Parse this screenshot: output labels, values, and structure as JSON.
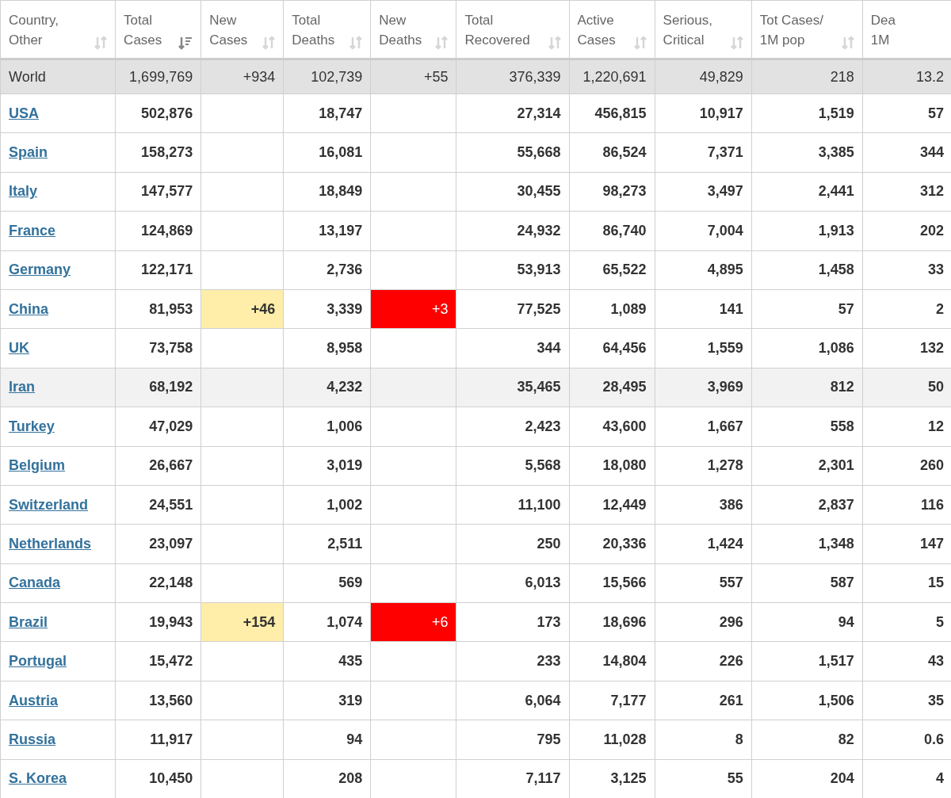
{
  "table": {
    "columns": [
      {
        "kind": "sortable",
        "lines": [
          "Country,",
          "Other"
        ],
        "sorted": false
      },
      {
        "kind": "sortable",
        "lines": [
          "Total",
          "Cases"
        ],
        "sorted": true
      },
      {
        "kind": "sortable",
        "lines": [
          "New",
          "Cases"
        ],
        "sorted": false
      },
      {
        "kind": "sortable",
        "lines": [
          "Total",
          "Deaths"
        ],
        "sorted": false
      },
      {
        "kind": "sortable",
        "lines": [
          "New",
          "Deaths"
        ],
        "sorted": false
      },
      {
        "kind": "sortable",
        "lines": [
          "Total",
          "Recovered"
        ],
        "sorted": false
      },
      {
        "kind": "sortable",
        "lines": [
          "Active",
          "Cases"
        ],
        "sorted": false
      },
      {
        "kind": "sortable",
        "lines": [
          "Serious,",
          "Critical"
        ],
        "sorted": false
      },
      {
        "kind": "sortable",
        "lines": [
          "Tot Cases/",
          "1M pop"
        ],
        "sorted": false
      },
      {
        "kind": "plain",
        "lines": [
          "Dea",
          "1M"
        ]
      }
    ],
    "rows": [
      {
        "kind": "total",
        "name": "World",
        "total_cases": "1,699,769",
        "new_cases": "+934",
        "total_deaths": "102,739",
        "new_deaths": "+55",
        "recovered": "376,339",
        "active": "1,220,691",
        "serious": "49,829",
        "per_million": "218",
        "deaths_per_million": "13.2"
      },
      {
        "kind": "country",
        "highlighted": false,
        "name": "USA",
        "total_cases": "502,876",
        "total_deaths": "18,747",
        "recovered": "27,314",
        "active": "456,815",
        "serious": "10,917",
        "per_million": "1,519",
        "deaths_per_million": "57"
      },
      {
        "kind": "country",
        "highlighted": false,
        "name": "Spain",
        "total_cases": "158,273",
        "total_deaths": "16,081",
        "recovered": "55,668",
        "active": "86,524",
        "serious": "7,371",
        "per_million": "3,385",
        "deaths_per_million": "344"
      },
      {
        "kind": "country",
        "highlighted": false,
        "name": "Italy",
        "total_cases": "147,577",
        "total_deaths": "18,849",
        "recovered": "30,455",
        "active": "98,273",
        "serious": "3,497",
        "per_million": "2,441",
        "deaths_per_million": "312"
      },
      {
        "kind": "country",
        "highlighted": false,
        "name": "France",
        "total_cases": "124,869",
        "total_deaths": "13,197",
        "recovered": "24,932",
        "active": "86,740",
        "serious": "7,004",
        "per_million": "1,913",
        "deaths_per_million": "202"
      },
      {
        "kind": "country",
        "highlighted": false,
        "name": "Germany",
        "total_cases": "122,171",
        "total_deaths": "2,736",
        "recovered": "53,913",
        "active": "65,522",
        "serious": "4,895",
        "per_million": "1,458",
        "deaths_per_million": "33"
      },
      {
        "kind": "country",
        "highlighted": false,
        "name": "China",
        "total_cases": "81,953",
        "new_cases": "+46",
        "total_deaths": "3,339",
        "new_deaths": "+3",
        "recovered": "77,525",
        "active": "1,089",
        "serious": "141",
        "per_million": "57",
        "deaths_per_million": "2"
      },
      {
        "kind": "country",
        "highlighted": false,
        "name": "UK",
        "total_cases": "73,758",
        "total_deaths": "8,958",
        "recovered": "344",
        "active": "64,456",
        "serious": "1,559",
        "per_million": "1,086",
        "deaths_per_million": "132"
      },
      {
        "kind": "country",
        "highlighted": true,
        "name": "Iran",
        "total_cases": "68,192",
        "total_deaths": "4,232",
        "recovered": "35,465",
        "active": "28,495",
        "serious": "3,969",
        "per_million": "812",
        "deaths_per_million": "50"
      },
      {
        "kind": "country",
        "highlighted": false,
        "name": "Turkey",
        "total_cases": "47,029",
        "total_deaths": "1,006",
        "recovered": "2,423",
        "active": "43,600",
        "serious": "1,667",
        "per_million": "558",
        "deaths_per_million": "12"
      },
      {
        "kind": "country",
        "highlighted": false,
        "name": "Belgium",
        "total_cases": "26,667",
        "total_deaths": "3,019",
        "recovered": "5,568",
        "active": "18,080",
        "serious": "1,278",
        "per_million": "2,301",
        "deaths_per_million": "260"
      },
      {
        "kind": "country",
        "highlighted": false,
        "name": "Switzerland",
        "total_cases": "24,551",
        "total_deaths": "1,002",
        "recovered": "11,100",
        "active": "12,449",
        "serious": "386",
        "per_million": "2,837",
        "deaths_per_million": "116"
      },
      {
        "kind": "country",
        "highlighted": false,
        "name": "Netherlands",
        "total_cases": "23,097",
        "total_deaths": "2,511",
        "recovered": "250",
        "active": "20,336",
        "serious": "1,424",
        "per_million": "1,348",
        "deaths_per_million": "147"
      },
      {
        "kind": "country",
        "highlighted": false,
        "name": "Canada",
        "total_cases": "22,148",
        "total_deaths": "569",
        "recovered": "6,013",
        "active": "15,566",
        "serious": "557",
        "per_million": "587",
        "deaths_per_million": "15"
      },
      {
        "kind": "country",
        "highlighted": false,
        "name": "Brazil",
        "total_cases": "19,943",
        "new_cases": "+154",
        "total_deaths": "1,074",
        "new_deaths": "+6",
        "recovered": "173",
        "active": "18,696",
        "serious": "296",
        "per_million": "94",
        "deaths_per_million": "5"
      },
      {
        "kind": "country",
        "highlighted": false,
        "name": "Portugal",
        "total_cases": "15,472",
        "total_deaths": "435",
        "recovered": "233",
        "active": "14,804",
        "serious": "226",
        "per_million": "1,517",
        "deaths_per_million": "43"
      },
      {
        "kind": "country",
        "highlighted": false,
        "name": "Austria",
        "total_cases": "13,560",
        "total_deaths": "319",
        "recovered": "6,064",
        "active": "7,177",
        "serious": "261",
        "per_million": "1,506",
        "deaths_per_million": "35"
      },
      {
        "kind": "country",
        "highlighted": false,
        "name": "Russia",
        "total_cases": "11,917",
        "total_deaths": "94",
        "recovered": "795",
        "active": "11,028",
        "serious": "8",
        "per_million": "82",
        "deaths_per_million": "0.6"
      },
      {
        "kind": "country",
        "highlighted": false,
        "name": "S. Korea",
        "total_cases": "10,450",
        "total_deaths": "208",
        "recovered": "7,117",
        "active": "3,125",
        "serious": "55",
        "per_million": "204",
        "deaths_per_million": "4"
      }
    ]
  }
}
